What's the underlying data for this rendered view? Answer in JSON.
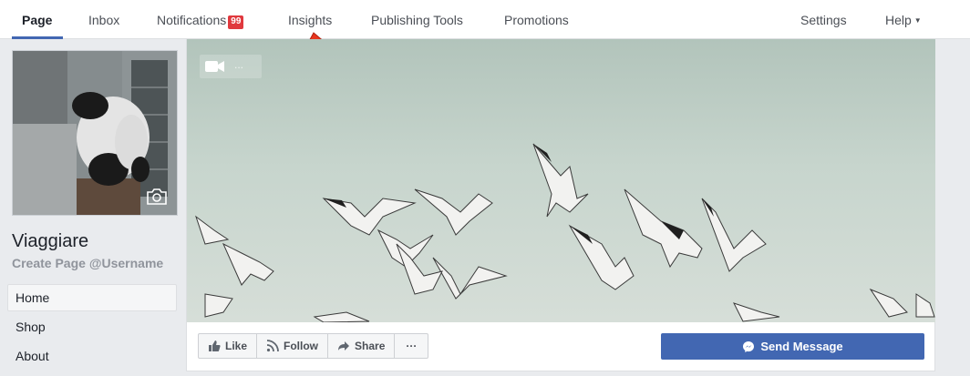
{
  "nav": {
    "page": "Page",
    "inbox": "Inbox",
    "notifications": "Notifications",
    "notifications_count": "99",
    "insights": "Insights",
    "publishing_tools": "Publishing Tools",
    "promotions": "Promotions",
    "settings": "Settings",
    "help": "Help"
  },
  "profile": {
    "name": "Viaggiare",
    "username_link": "Create Page @Username"
  },
  "sidebar": {
    "items": [
      {
        "label": "Home",
        "active": true
      },
      {
        "label": "Shop",
        "active": false
      },
      {
        "label": "About",
        "active": false
      }
    ]
  },
  "cover": {
    "video_label": "..."
  },
  "actions": {
    "like": "Like",
    "follow": "Follow",
    "share": "Share",
    "more": "···",
    "send_message": "Send Message"
  },
  "colors": {
    "accent": "#4267b2",
    "badge": "#e0393e",
    "annotation_arrow": "#e8361e"
  },
  "icons": [
    "chevron-down-icon",
    "camera-icon",
    "video-icon",
    "like-icon",
    "follow-icon",
    "share-icon",
    "messenger-icon",
    "red-arrow-icon"
  ]
}
